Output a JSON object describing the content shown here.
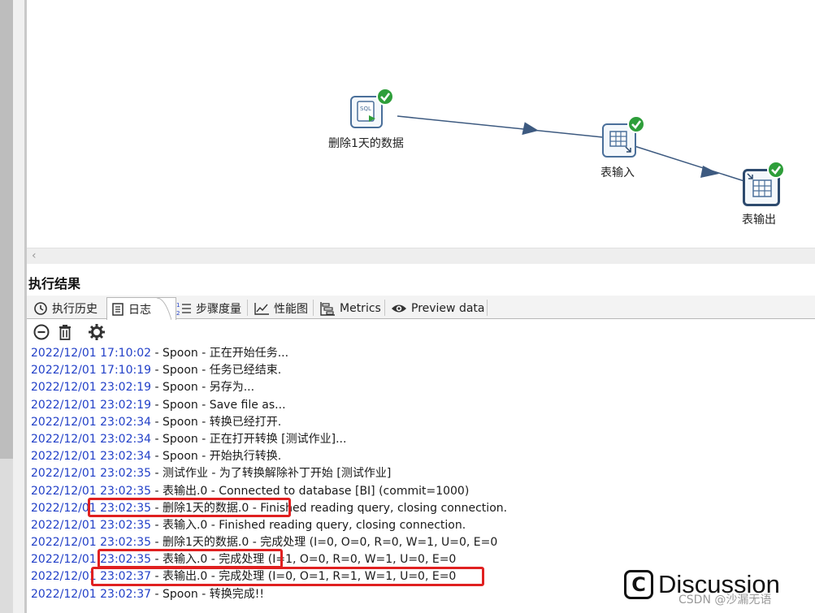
{
  "canvas": {
    "steps": [
      {
        "label": "删除1天的数据",
        "icon": "sql-script-icon",
        "status": "success"
      },
      {
        "label": "表输入",
        "icon": "table-input-icon",
        "status": "success"
      },
      {
        "label": "表输出",
        "icon": "table-output-icon",
        "status": "success"
      }
    ]
  },
  "results": {
    "title": "执行结果",
    "tabs": [
      {
        "label": "执行历史",
        "icon": "history-icon",
        "active": false
      },
      {
        "label": "日志",
        "icon": "log-icon",
        "active": true
      },
      {
        "label": "步骤度量",
        "icon": "step-metrics-icon",
        "active": false
      },
      {
        "label": "性能图",
        "icon": "performance-chart-icon",
        "active": false
      },
      {
        "label": "Metrics",
        "icon": "metrics-icon",
        "active": false
      },
      {
        "label": "Preview data",
        "icon": "preview-eye-icon",
        "active": false
      }
    ],
    "toolbar": [
      "clear-log-icon",
      "delete-icon",
      "settings-gear-icon"
    ]
  },
  "log": [
    {
      "ts": "2022/12/01 17:10:02",
      "msg": " - Spoon - 正在开始任务..."
    },
    {
      "ts": "2022/12/01 17:10:19",
      "msg": " - Spoon - 任务已经结束."
    },
    {
      "ts": "2022/12/01 23:02:19",
      "msg": " - Spoon - 另存为..."
    },
    {
      "ts": "2022/12/01 23:02:19",
      "msg": " - Spoon - Save file as..."
    },
    {
      "ts": "2022/12/01 23:02:34",
      "msg": " - Spoon - 转换已经打开."
    },
    {
      "ts": "2022/12/01 23:02:34",
      "msg": " - Spoon - 正在打开转换 [测试作业]..."
    },
    {
      "ts": "2022/12/01 23:02:34",
      "msg": " - Spoon - 开始执行转换."
    },
    {
      "ts": "2022/12/01 23:02:35",
      "msg": " - 测试作业 - 为了转换解除补丁开始  [测试作业]"
    },
    {
      "ts": "2022/12/01 23:02:35",
      "msg": " - 表输出.0 - Connected to database [BI] (commit=1000)"
    },
    {
      "ts": "2022/12/01 23:02:35",
      "msg": " - 删除1天的数据.0 - Finished reading query, closing connection."
    },
    {
      "ts": "2022/12/01 23:02:35",
      "msg": " - 表输入.0 - Finished reading query, closing connection."
    },
    {
      "ts": "2022/12/01 23:02:35",
      "msg": " - 删除1天的数据.0 - 完成处理 (I=0, O=0, R=0, W=1, U=0, E=0"
    },
    {
      "ts": "2022/12/01 23:02:35",
      "msg": " - 表输入.0 - 完成处理 (I=1, O=0, R=0, W=1, U=0, E=0"
    },
    {
      "ts": "2022/12/01 23:02:37",
      "msg": " - 表输出.0 - 完成处理 (I=0, O=1, R=1, W=1, U=0, E=0"
    },
    {
      "ts": "2022/12/01 23:02:37",
      "msg": " - Spoon - 转换完成!!"
    }
  ],
  "watermark": {
    "logo": "C",
    "text": "Discussion",
    "credit": "CSDN @沙漏无语"
  },
  "colors": {
    "timestamp": "#2240c8",
    "highlight": "#e02020",
    "success": "#2e9e3a",
    "step_border": "#4a6f9a",
    "hop_arrow": "#3d5a80"
  }
}
